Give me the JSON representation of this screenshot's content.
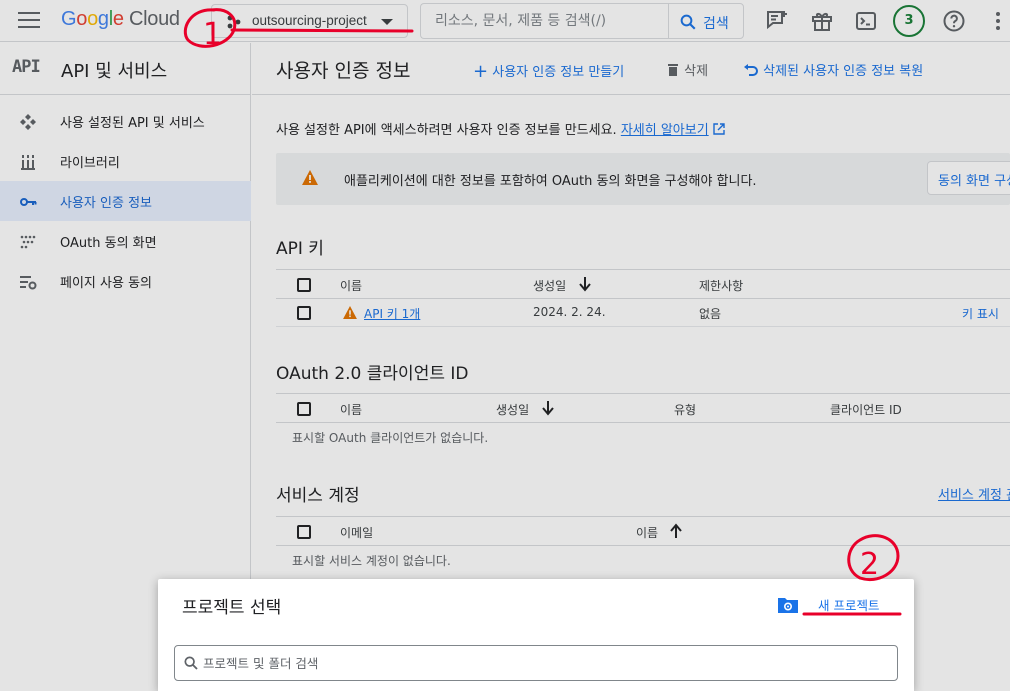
{
  "topbar": {
    "logo_google": "Google",
    "logo_cloud": "Cloud",
    "project_name": "outsourcing-project",
    "search_placeholder": "리소스, 문서, 제품 등 검색(/)",
    "search_button": "검색",
    "avatar_count": "3"
  },
  "sidebar": {
    "header_mark": "API",
    "header_title": "API 및 서비스",
    "items": [
      {
        "label": "사용 설정된 API 및 서비스",
        "icon": "api-services-icon"
      },
      {
        "label": "라이브러리",
        "icon": "library-icon"
      },
      {
        "label": "사용자 인증 정보",
        "icon": "key-icon",
        "active": true
      },
      {
        "label": "OAuth 동의 화면",
        "icon": "oauth-consent-icon"
      },
      {
        "label": "페이지 사용 동의",
        "icon": "page-usage-icon"
      }
    ]
  },
  "main": {
    "title": "사용자 인증 정보",
    "create_button": "사용자 인증 정보 만들기",
    "delete_button": "삭제",
    "restore_button": "삭제된 사용자 인증 정보 복원",
    "intro_text": "사용 설정한 API에 액세스하려면 사용자 인증 정보를 만드세요.",
    "intro_link": "자세히 알아보기",
    "banner_text": "애플리케이션에 대한 정보를 포함하여 OAuth 동의 화면을 구성해야 합니다.",
    "banner_button": "동의 화면 구성",
    "api_keys": {
      "title": "API 키",
      "columns": [
        "이름",
        "생성일",
        "제한사항"
      ],
      "rows": [
        {
          "name": "API 키 1개",
          "created": "2024. 2. 24.",
          "restriction": "없음",
          "action": "키 표시"
        }
      ]
    },
    "oauth": {
      "title": "OAuth 2.0 클라이언트 ID",
      "columns": [
        "이름",
        "생성일",
        "유형",
        "클라이언트 ID"
      ],
      "empty": "표시할 OAuth 클라이언트가 없습니다."
    },
    "service_accounts": {
      "title": "서비스 계정",
      "manage_link": "서비스 계정 관리",
      "columns": [
        "이메일",
        "이름"
      ],
      "empty": "표시할 서비스 계정이 없습니다."
    }
  },
  "dialog": {
    "title": "프로젝트 선택",
    "new_project": "새 프로젝트",
    "search_placeholder": "프로젝트 및 폴더 검색"
  },
  "annotations": {
    "color": "#e8002a",
    "step1": "1",
    "step2": "2"
  }
}
